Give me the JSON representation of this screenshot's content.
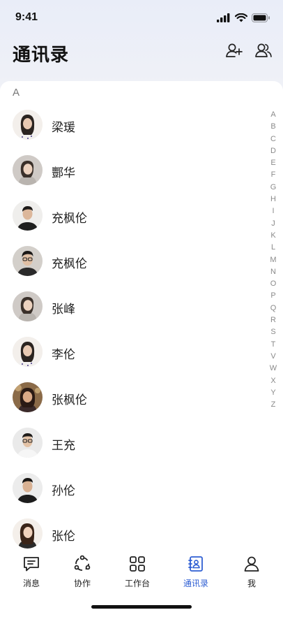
{
  "status_bar": {
    "time": "9:41"
  },
  "header": {
    "title": "通讯录",
    "add_contact_icon": "add-user-icon",
    "group_icon": "group-icon"
  },
  "section": {
    "letter": "A"
  },
  "contacts": [
    {
      "name": "梁瑗",
      "avatar_tone": "#d9cfc6"
    },
    {
      "name": "酆华",
      "avatar_tone": "#c9c3bd"
    },
    {
      "name": "充枫伦",
      "avatar_tone": "#e6e2dd"
    },
    {
      "name": "充枫伦",
      "avatar_tone": "#cfcac3"
    },
    {
      "name": "张峰",
      "avatar_tone": "#c9c3bd"
    },
    {
      "name": "李伦",
      "avatar_tone": "#ddd6cf"
    },
    {
      "name": "张枫伦",
      "avatar_tone": "#7a5a3c"
    },
    {
      "name": "王充",
      "avatar_tone": "#e4e4e4"
    },
    {
      "name": "孙伦",
      "avatar_tone": "#e8e8e8"
    },
    {
      "name": "张伦",
      "avatar_tone": "#efe9e4"
    }
  ],
  "alpha_index": [
    "A",
    "B",
    "C",
    "D",
    "E",
    "F",
    "G",
    "H",
    "I",
    "J",
    "K",
    "L",
    "M",
    "N",
    "O",
    "P",
    "Q",
    "R",
    "S",
    "T",
    "V",
    "W",
    "X",
    "Y",
    "Z"
  ],
  "tabs": [
    {
      "label": "消息",
      "icon": "message-icon",
      "active": false
    },
    {
      "label": "协作",
      "icon": "collaborate-icon",
      "active": false
    },
    {
      "label": "工作台",
      "icon": "workbench-icon",
      "active": false
    },
    {
      "label": "通讯录",
      "icon": "contacts-icon",
      "active": true
    },
    {
      "label": "我",
      "icon": "profile-icon",
      "active": false
    }
  ],
  "colors": {
    "accent": "#2f5fd3",
    "text": "#222222",
    "index_text": "#8a8a8a"
  }
}
